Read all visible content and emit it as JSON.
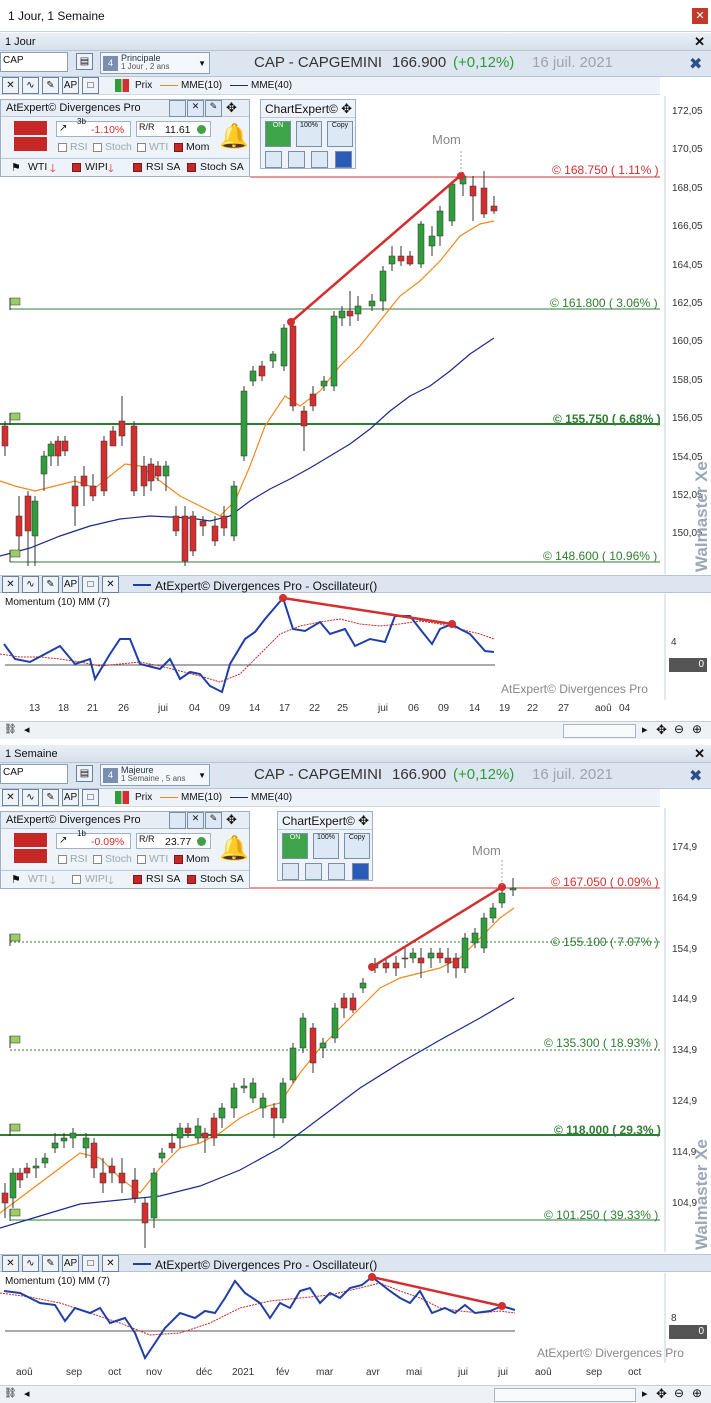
{
  "window": {
    "title": "1 Jour, 1 Semaine",
    "close_icon": "close-icon"
  },
  "colors": {
    "accent": "#1f3fa8",
    "up": "#2e9d3a",
    "down": "#d32f2f",
    "ema10": "#f08a1e",
    "ema40": "#1b2a8a"
  },
  "common": {
    "symbol": "CAP",
    "title": "CAP - CAPGEMINI",
    "price": "166.900",
    "change": "(+0,12%)",
    "date": "16 juil. 2021",
    "legend": {
      "prix": "Prix",
      "ema10": "MME(10)",
      "ema40": "MME(40)"
    },
    "expert": {
      "title": "AtExpert© Divergences Pro",
      "rsi": "RSI",
      "stoch": "Stoch",
      "wti": "WTI",
      "mom": "Mom",
      "wipi": "WIPI",
      "rsi_sa": "RSI SA",
      "stoch_sa": "Stoch SA"
    },
    "chartexpert": {
      "title": "ChartExpert©",
      "on": "ON",
      "pct": "100%",
      "copy": "Copy"
    },
    "osc_header": "AtExpert© Divergences Pro - Oscillateur()",
    "osc_label": "Momentum (10) MM (7)",
    "watermark": "AtExpert© Divergences Pro",
    "brand": "Walmaster Xe",
    "mom_label": "Mom"
  },
  "panel1": {
    "header": "1 Jour",
    "dropdown": {
      "name": "Principale",
      "period": "1 Jour , 2 ans"
    },
    "expert": {
      "pct": "-1.10%",
      "val": "11.61",
      "sub": "3b"
    },
    "levels": [
      {
        "text": "© 168.750 ( 1.11% )",
        "color": "red"
      },
      {
        "text": "© 161.800 ( 3.06% )",
        "color": "green"
      },
      {
        "text": "© 155.750 ( 6.68% )",
        "color": "green"
      },
      {
        "text": "© 148.600 ( 10.96% )",
        "color": "green"
      }
    ],
    "yaxis": [
      "172,05",
      "170,05",
      "168,05",
      "166,05",
      "164,05",
      "162,05",
      "160,05",
      "158,05",
      "156,05",
      "154,05",
      "152,05",
      "150,05"
    ],
    "xaxis": [
      "13",
      "18",
      "21",
      "26",
      "jui",
      "04",
      "09",
      "14",
      "17",
      "22",
      "25",
      "jui",
      "06",
      "09",
      "14",
      "19",
      "22",
      "27",
      "aoû",
      "04"
    ],
    "osc_value": "4",
    "osc_box": "0"
  },
  "panel2": {
    "header": "1 Semaine",
    "dropdown": {
      "name": "Majeure",
      "period": "1 Semaine , 5 ans"
    },
    "expert": {
      "pct": "-0.09%",
      "val": "23.77",
      "sub": "1b"
    },
    "levels": [
      {
        "text": "© 167.050 ( 0.09% )",
        "color": "red"
      },
      {
        "text": "© 155.100 ( 7.07% )",
        "color": "green"
      },
      {
        "text": "© 135.300 ( 18.93% )",
        "color": "green"
      },
      {
        "text": "© 118.000 ( 29.3% )",
        "color": "green"
      },
      {
        "text": "© 101.250 ( 39.33% )",
        "color": "green"
      }
    ],
    "yaxis": [
      "174,9",
      "164,9",
      "154,9",
      "144,9",
      "134,9",
      "124,9",
      "114,9",
      "104,9"
    ],
    "xaxis": [
      "aoû",
      "sep",
      "oct",
      "nov",
      "déc",
      "2021",
      "fév",
      "mar",
      "avr",
      "mai",
      "jui",
      "jui",
      "aoû",
      "sep",
      "oct"
    ],
    "osc_value": "8",
    "osc_box": "0"
  }
}
